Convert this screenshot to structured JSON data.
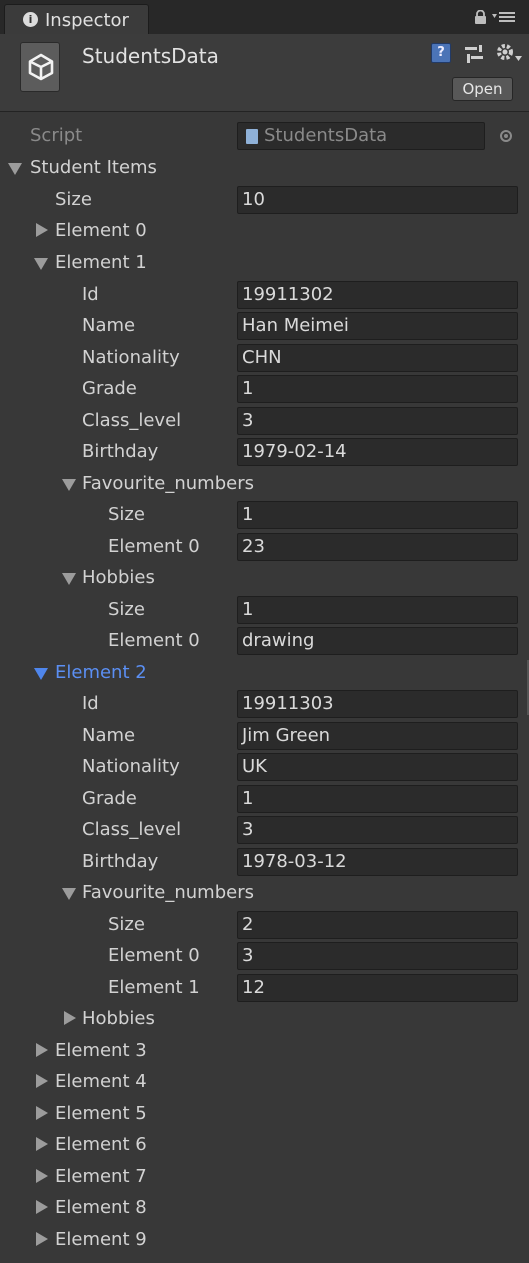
{
  "tab": {
    "title": "Inspector"
  },
  "header": {
    "object_name": "StudentsData",
    "open_label": "Open"
  },
  "script_field": {
    "label": "Script",
    "value": "StudentsData"
  },
  "list": {
    "label": "Student Items",
    "size_label": "Size",
    "size_value": "10",
    "element_0": "Element 0",
    "element_1": {
      "label": "Element 1",
      "id_label": "Id",
      "id": "19911302",
      "name_label": "Name",
      "name": "Han Meimei",
      "nationality_label": "Nationality",
      "nationality": "CHN",
      "grade_label": "Grade",
      "grade": "1",
      "class_level_label": "Class_level",
      "class_level": "3",
      "birthday_label": "Birthday",
      "birthday": "1979-02-14",
      "favourite_numbers": {
        "label": "Favourite_numbers",
        "size_label": "Size",
        "size": "1",
        "items": [
          {
            "label": "Element 0",
            "value": "23"
          }
        ]
      },
      "hobbies": {
        "label": "Hobbies",
        "size_label": "Size",
        "size": "1",
        "items": [
          {
            "label": "Element 0",
            "value": "drawing"
          }
        ]
      }
    },
    "element_2": {
      "label": "Element 2",
      "id_label": "Id",
      "id": "19911303",
      "name_label": "Name",
      "name": "Jim Green",
      "nationality_label": "Nationality",
      "nationality": "UK",
      "grade_label": "Grade",
      "grade": "1",
      "class_level_label": "Class_level",
      "class_level": "3",
      "birthday_label": "Birthday",
      "birthday": "1978-03-12",
      "favourite_numbers": {
        "label": "Favourite_numbers",
        "size_label": "Size",
        "size": "2",
        "items": [
          {
            "label": "Element 0",
            "value": "3"
          },
          {
            "label": "Element 1",
            "value": "12"
          }
        ]
      },
      "hobbies": {
        "label": "Hobbies"
      }
    },
    "collapsed": [
      "Element 3",
      "Element 4",
      "Element 5",
      "Element 6",
      "Element 7",
      "Element 8",
      "Element 9"
    ]
  },
  "colors": {
    "background": "#383838",
    "field": "#2b2b2b",
    "selected": "#5b8ff3",
    "text": "#d2d2d2"
  },
  "icons": [
    "info-icon",
    "lock-icon",
    "menu-icon",
    "unity-logo-icon",
    "help-icon",
    "preset-icon",
    "gear-icon",
    "script-file-icon",
    "target-icon",
    "foldout-arrow-icon"
  ]
}
